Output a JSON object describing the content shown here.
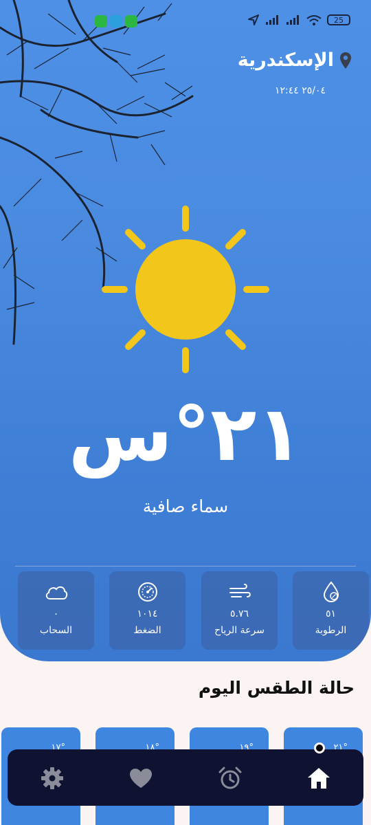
{
  "status_bar": {
    "notification_icons": [
      "whatsapp-icon",
      "telegram-icon",
      "whatsapp-icon"
    ],
    "system_icons": [
      "location-arrow-icon",
      "signal-icon",
      "signal-icon",
      "wifi-icon"
    ],
    "battery": "25"
  },
  "location": {
    "city": "الإسكندرية",
    "icon": "map-pin-icon",
    "datetime": "٢٥/٠٤ ١٢:٤٤"
  },
  "current": {
    "icon": "sun-icon",
    "temperature": "٢١°س",
    "condition": "سماء صافية"
  },
  "stats": [
    {
      "icon": "cloud-icon",
      "value": "٠",
      "label": "السحاب"
    },
    {
      "icon": "gauge-icon",
      "value": "١٠١٤",
      "label": "الضغط"
    },
    {
      "icon": "wind-icon",
      "value": "٥.٧٦",
      "label": "سرعة الرياح"
    },
    {
      "icon": "humidity-icon",
      "value": "٥١",
      "label": "الرطوبة"
    }
  ],
  "today": {
    "title": "حالة الطقس اليوم",
    "hours": [
      {
        "temp": "°١٧"
      },
      {
        "temp": "°١٨"
      },
      {
        "temp": "°١٩"
      },
      {
        "temp": "°٢١"
      }
    ]
  },
  "nav": {
    "items": [
      "settings-icon",
      "heart-icon",
      "alarm-icon",
      "home-icon"
    ],
    "active": "home-icon"
  },
  "colors": {
    "sky_blue": "#4a8be0",
    "sun_yellow": "#f2c61a",
    "nav_bg": "#0f1231",
    "page_bg": "#fbf4f3"
  }
}
